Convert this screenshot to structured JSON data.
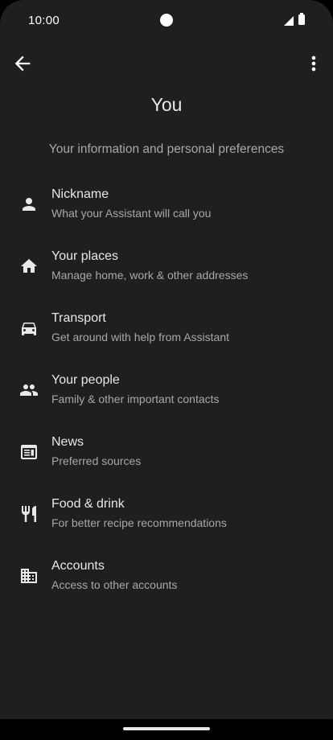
{
  "status": {
    "time": "10:00"
  },
  "header": {
    "title": "You",
    "subtitle": "Your information and personal preferences"
  },
  "items": [
    {
      "icon": "person-icon",
      "title": "Nickname",
      "subtitle": "What your Assistant will call you"
    },
    {
      "icon": "home-icon",
      "title": "Your places",
      "subtitle": "Manage home, work & other addresses"
    },
    {
      "icon": "car-icon",
      "title": "Transport",
      "subtitle": "Get around with help from Assistant"
    },
    {
      "icon": "people-icon",
      "title": "Your people",
      "subtitle": "Family & other important contacts"
    },
    {
      "icon": "news-icon",
      "title": "News",
      "subtitle": "Preferred sources"
    },
    {
      "icon": "restaurant-icon",
      "title": "Food & drink",
      "subtitle": "For better recipe recommendations"
    },
    {
      "icon": "business-icon",
      "title": "Accounts",
      "subtitle": "Access to other accounts"
    }
  ]
}
